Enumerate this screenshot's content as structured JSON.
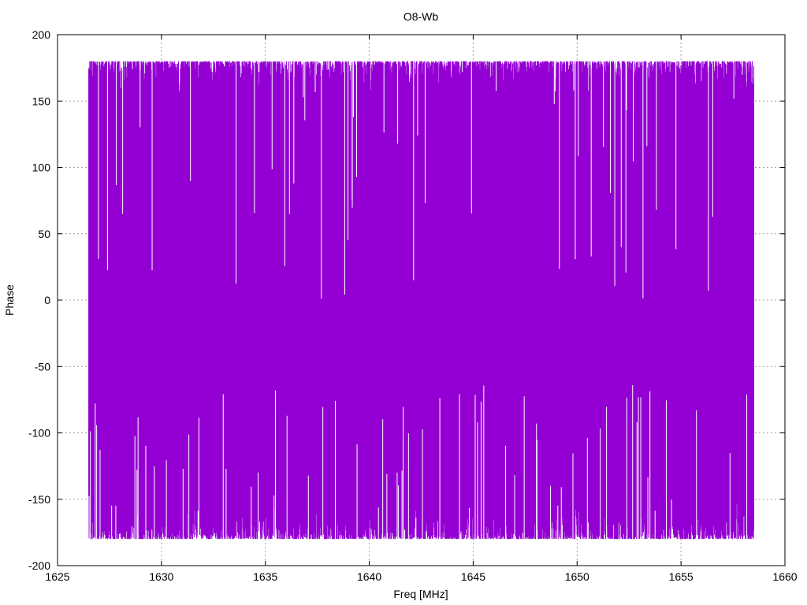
{
  "chart_data": {
    "type": "line",
    "title": "O8-Wb",
    "xlabel": "Freq [MHz]",
    "ylabel": "Phase",
    "xlim": [
      1625,
      1660
    ],
    "ylim": [
      -200,
      200
    ],
    "x_ticks": [
      1625,
      1630,
      1635,
      1640,
      1645,
      1650,
      1655,
      1660
    ],
    "y_ticks": [
      -200,
      -150,
      -100,
      -50,
      0,
      50,
      100,
      150,
      200
    ],
    "grid": true,
    "series": [
      {
        "color": "#9400d3",
        "x_range": [
          1626.5,
          1658.5
        ],
        "value_range": [
          -180,
          180
        ],
        "description_note": "dense oscillating phase data spanning -180 to 180"
      }
    ]
  }
}
